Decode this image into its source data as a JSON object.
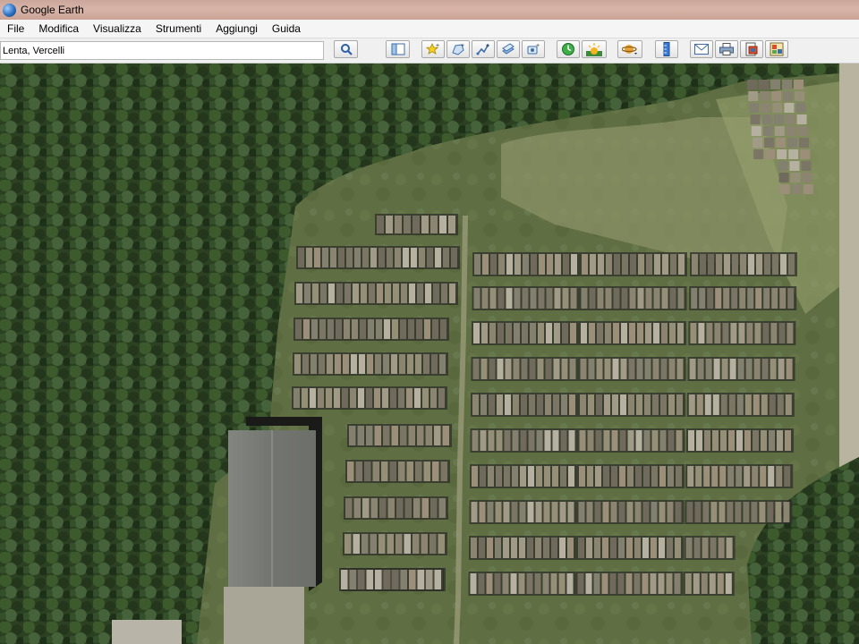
{
  "window": {
    "title": "Google Earth"
  },
  "menu": {
    "items": [
      {
        "label": "File"
      },
      {
        "label": "Modifica"
      },
      {
        "label": "Visualizza"
      },
      {
        "label": "Strumenti"
      },
      {
        "label": "Aggiungi"
      },
      {
        "label": "Guida"
      }
    ]
  },
  "search": {
    "value": "Lenta, Vercelli"
  },
  "toolbar": {
    "icons": [
      "search-icon",
      "sidebar-toggle-icon",
      "add-placemark-icon",
      "add-polygon-icon",
      "add-path-icon",
      "add-image-overlay-icon",
      "record-tour-icon",
      "historical-imagery-icon",
      "sunlight-icon",
      "planets-icon",
      "ruler-icon",
      "email-icon",
      "print-icon",
      "save-image-icon",
      "view-in-maps-icon"
    ]
  },
  "map": {
    "imagery": "satellite-aerial-view",
    "colors": {
      "forest": "#2f4424",
      "grass": "#5e6e42",
      "roof": "#7a7d78"
    }
  }
}
